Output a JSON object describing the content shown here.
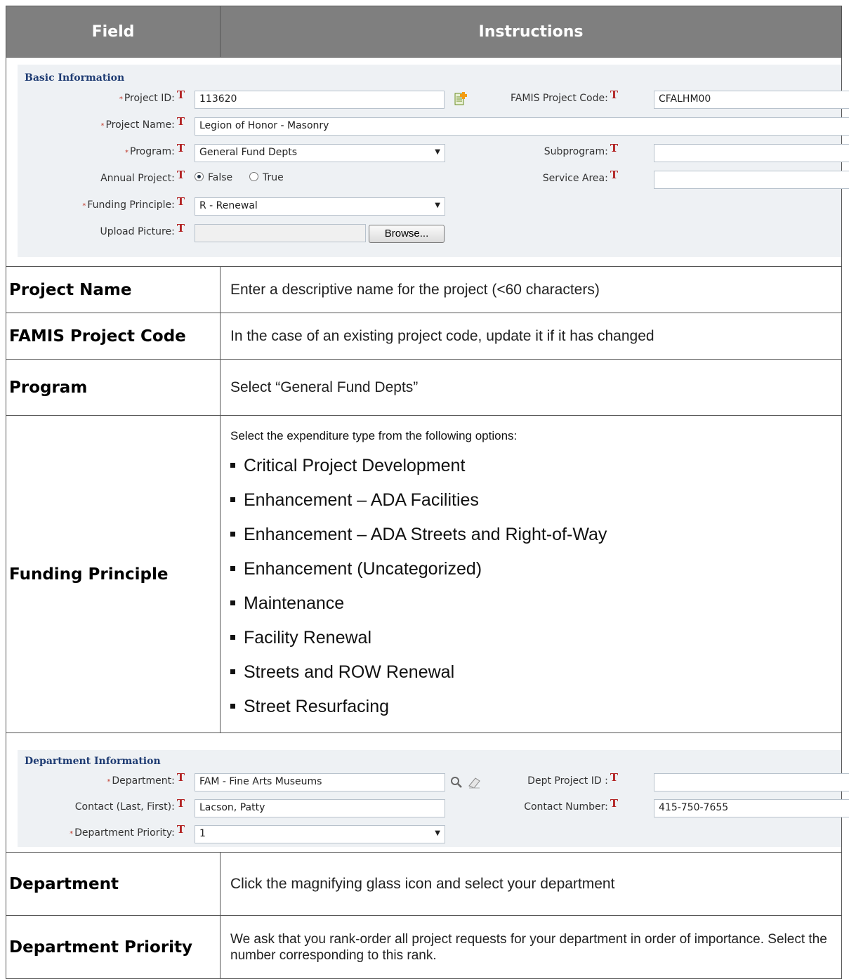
{
  "header": {
    "field": "Field",
    "instructions": "Instructions"
  },
  "basic": {
    "title": "Basic Information",
    "project_id_label": "Project ID:",
    "project_id_value": "113620",
    "famis_label": "FAMIS Project Code:",
    "famis_value": "CFALHM00",
    "project_name_label": "Project Name:",
    "project_name_value": "Legion of Honor - Masonry",
    "program_label": "Program:",
    "program_value": "General Fund Depts",
    "subprogram_label": "Subprogram:",
    "annual_label": "Annual Project:",
    "annual_false": "False",
    "annual_true": "True",
    "service_area_label": "Service Area:",
    "funding_label": "Funding Principle:",
    "funding_value": "R - Renewal",
    "upload_label": "Upload Picture:",
    "browse": "Browse...",
    "t_flag": "T",
    "req": "*"
  },
  "rows": {
    "project_name": {
      "field": "Project Name",
      "instr": "Enter a descriptive name for the project (<60 characters)"
    },
    "famis": {
      "field": "FAMIS Project Code",
      "instr": "In the case of an existing project code, update it if it has changed"
    },
    "program": {
      "field": "Program",
      "instr": "Select “General Fund Depts”"
    },
    "funding": {
      "field": "Funding Principle",
      "intro": "Select the expenditure type from the following options:",
      "options": [
        "Critical Project Development",
        "Enhancement – ADA Facilities",
        "Enhancement – ADA Streets and Right-of-Way",
        "Enhancement (Uncategorized)",
        "Maintenance",
        "Facility Renewal",
        "Streets and ROW Renewal",
        "Street Resurfacing"
      ]
    },
    "department": {
      "field": "Department",
      "instr": "Click the magnifying glass icon and select your department"
    },
    "dept_priority": {
      "field": "Department Priority",
      "instr": "We ask that you rank-order all project requests for your department in order of importance. Select the number corresponding to this rank."
    }
  },
  "dept": {
    "title": "Department Information",
    "department_label": "Department:",
    "department_value": "FAM - Fine Arts Museums",
    "dept_project_id_label": "Dept Project ID :",
    "contact_label": "Contact (Last, First):",
    "contact_value": "Lacson, Patty",
    "contact_number_label": "Contact Number:",
    "contact_number_value": "415-750-7655",
    "priority_label": "Department Priority:",
    "priority_value": "1"
  },
  "colors": {
    "header_bg": "#7f7f7f",
    "panel_bg": "#eef1f4",
    "section_title": "#1f3c73",
    "t_flag": "#b22222"
  }
}
